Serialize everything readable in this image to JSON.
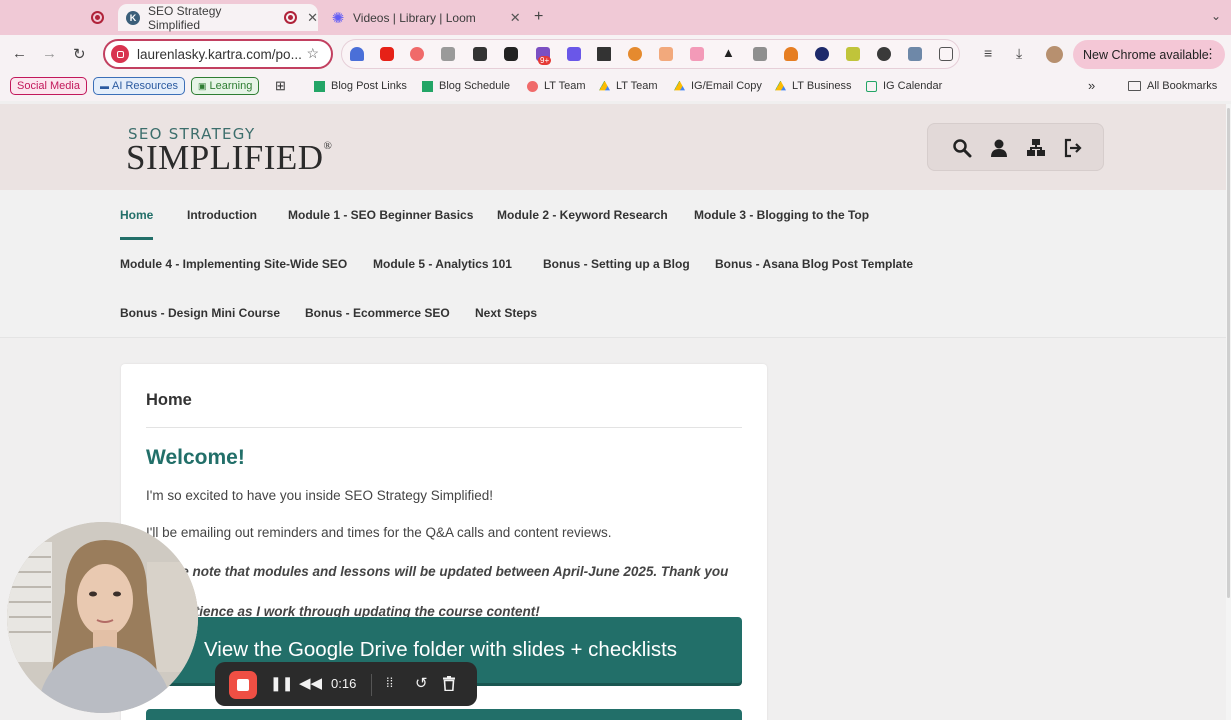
{
  "browser": {
    "tabs": [
      {
        "title": "SEO Strategy Simplified",
        "active": true,
        "favicon": "kartra-k-icon"
      },
      {
        "title": "Videos | Library | Loom",
        "active": false,
        "favicon": "loom-icon"
      }
    ],
    "url": "laurenlasky.kartra.com/po...",
    "new_chrome_label": "New Chrome available",
    "bookmark_groups": [
      {
        "label": "Social Media",
        "color": "#c2185b"
      },
      {
        "label": "AI Resources",
        "color": "#3b6fb8"
      },
      {
        "label": "Learning",
        "color": "#2e7d32"
      }
    ],
    "bookmarks": [
      {
        "label": "Blog Post Links",
        "icon": "sheets-icon"
      },
      {
        "label": "Blog Schedule",
        "icon": "sheets-icon"
      },
      {
        "label": "LT Team",
        "icon": "asana-icon"
      },
      {
        "label": "LT Team",
        "icon": "drive-icon"
      },
      {
        "label": "IG/Email Copy",
        "icon": "drive-icon"
      },
      {
        "label": "LT Business",
        "icon": "drive-icon"
      },
      {
        "label": "IG Calendar",
        "icon": "calendar-icon"
      }
    ],
    "overflow_label": "»",
    "all_bookmarks_label": "All Bookmarks",
    "extension_badge": "9+"
  },
  "site": {
    "logo_top": "SEO STRATEGY",
    "logo_main": "SIMPLIFIED",
    "logo_reg": "®",
    "nav": [
      "Home",
      "Introduction",
      "Module 1 - SEO Beginner Basics",
      "Module 2 - Keyword Research",
      "Module 3 - Blogging to the Top",
      "Module 4 - Implementing Site-Wide SEO",
      "Module 5 - Analytics 101",
      "Bonus - Setting up a Blog",
      "Bonus - Asana Blog Post Template",
      "Bonus - Design Mini Course",
      "Bonus - Ecommerce SEO",
      "Next Steps"
    ],
    "active_nav": "Home",
    "accent_color": "#226f69"
  },
  "content": {
    "page_title": "Home",
    "welcome": "Welcome!",
    "para1": "I'm so excited to have you inside SEO Strategy Simplified!",
    "para2": "I'll be emailing out reminders and times for the Q&A calls and content reviews.",
    "note_line1": "Please note that modules and lessons will be updated between April-June 2025. Thank you for",
    "note_line2": "your patience as I work through updating the course content!",
    "drive_button": "View the Google Drive folder with slides + checklists"
  },
  "loom": {
    "timer": "0:16",
    "stop_color": "#ef4f44"
  }
}
